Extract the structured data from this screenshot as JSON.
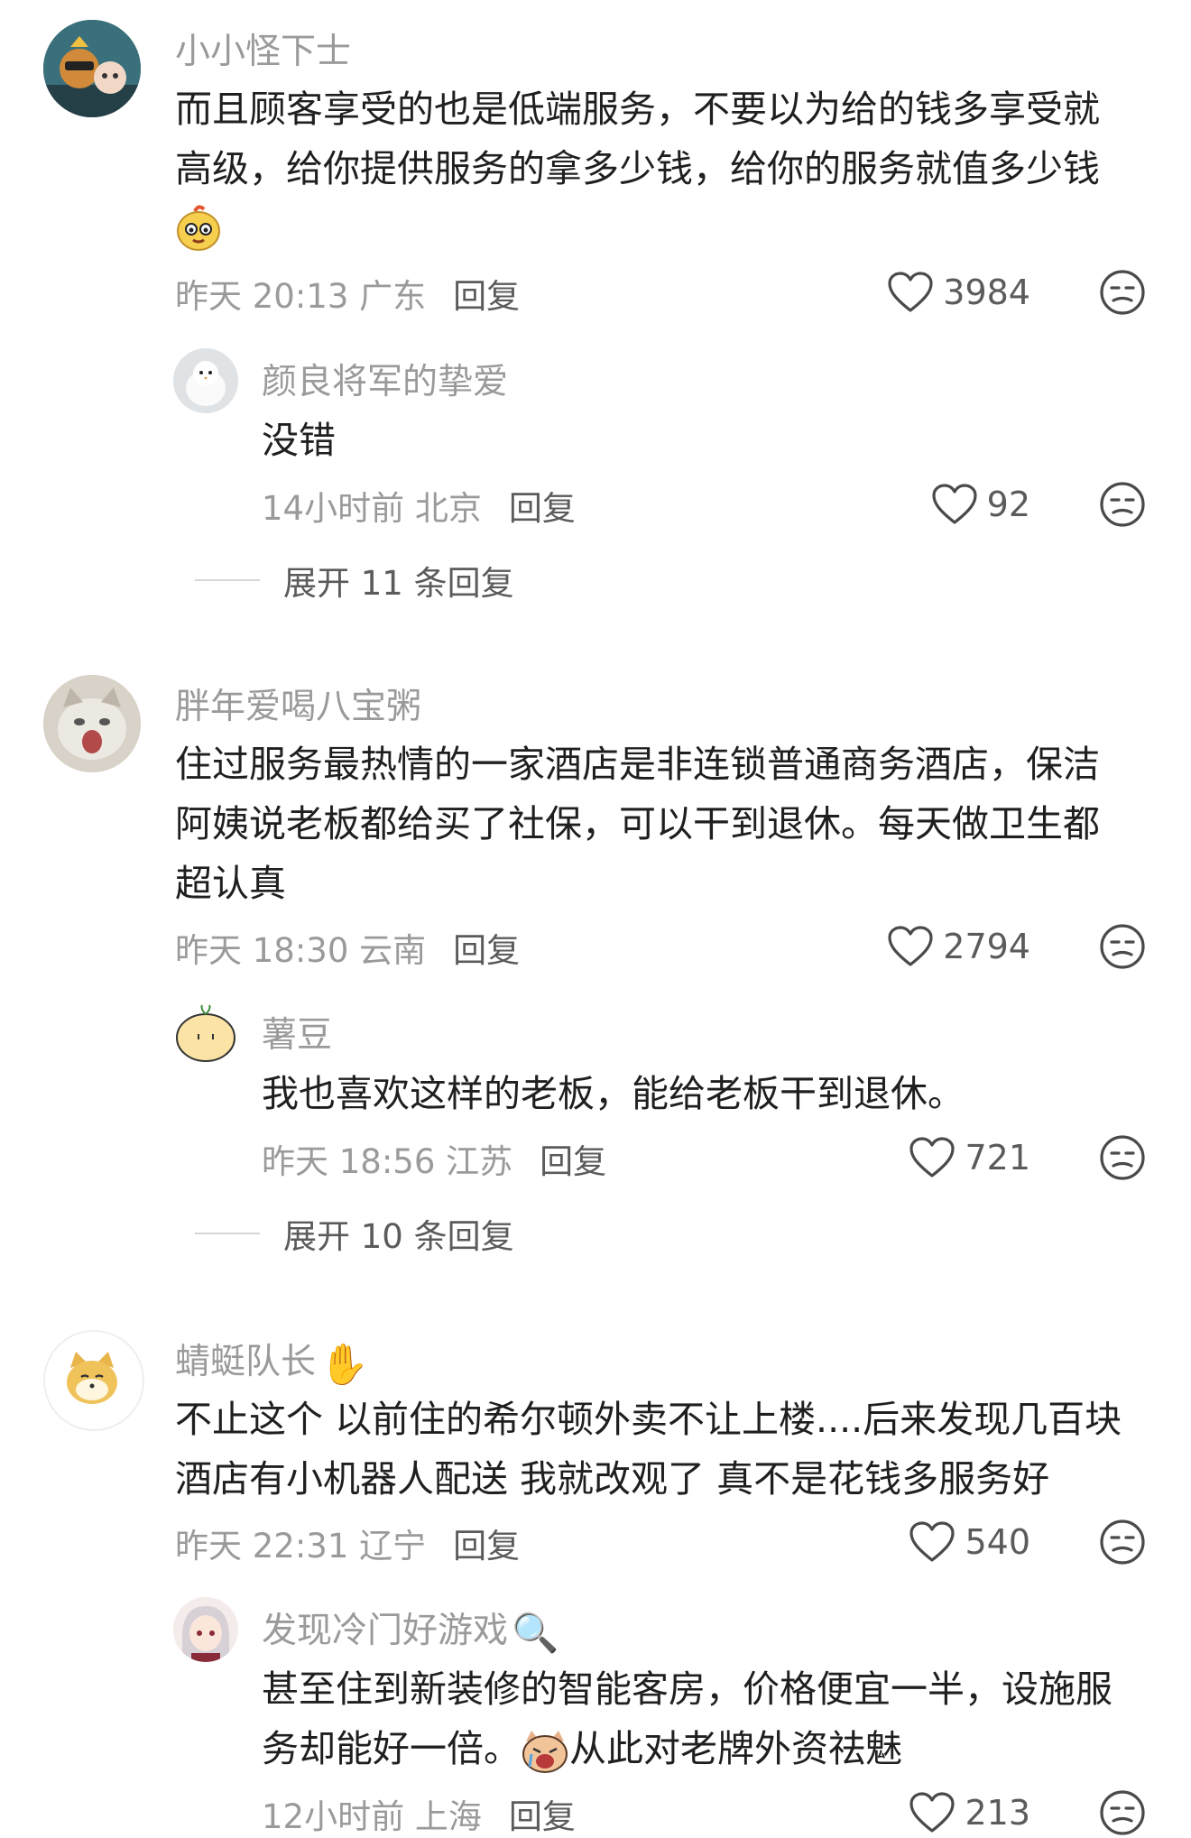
{
  "comments": [
    {
      "username": "小小怪下士",
      "text_lines": [
        "而且顾客享受的也是低端服务，不要以为给的钱多享受就",
        "高级，给你提供服务的拿多少钱，给你的服务就值多少钱"
      ],
      "time": "昨天 20:13 广东",
      "reply_label": "回复",
      "likes": "3984",
      "reply": {
        "username": "颜良将军的挚爱",
        "text": "没错",
        "time": "14小时前 北京",
        "reply_label": "回复",
        "likes": "92"
      },
      "expand_label": "展开 11 条回复"
    },
    {
      "username": "胖年爱喝八宝粥",
      "text_lines": [
        "住过服务最热情的一家酒店是非连锁普通商务酒店，保洁",
        "阿姨说老板都给买了社保，可以干到退休。每天做卫生都",
        "超认真"
      ],
      "time": "昨天 18:30 云南",
      "reply_label": "回复",
      "likes": "2794",
      "reply": {
        "username": "薯豆",
        "text": "我也喜欢这样的老板，能给老板干到退休。",
        "time": "昨天 18:56 江苏",
        "reply_label": "回复",
        "likes": "721"
      },
      "expand_label": "展开 10 条回复"
    },
    {
      "username": "蜻蜓队长",
      "username_emoji": "✋",
      "text_lines": [
        "不止这个 以前住的希尔顿外卖不让上楼....后来发现几百块",
        "酒店有小机器人配送 我就改观了 真不是花钱多服务好"
      ],
      "time": "昨天 22:31 辽宁",
      "reply_label": "回复",
      "likes": "540",
      "reply": {
        "username": "发现冷门好游戏",
        "username_emoji": "🔍",
        "text_lines": [
          "甚至住到新装修的智能客房，价格便宜一半，设施服",
          "务却能好一倍。",
          "从此对老牌外资祛魅"
        ],
        "time": "12小时前 上海",
        "reply_label": "回复",
        "likes": "213"
      }
    }
  ],
  "icons": {
    "like": "heart-outline-icon",
    "dislike": "unamused-face-icon"
  },
  "colors": {
    "meta_text": "#9a9a9a",
    "reply_text": "#5b5b5b",
    "body_text": "#1f1f1f"
  }
}
